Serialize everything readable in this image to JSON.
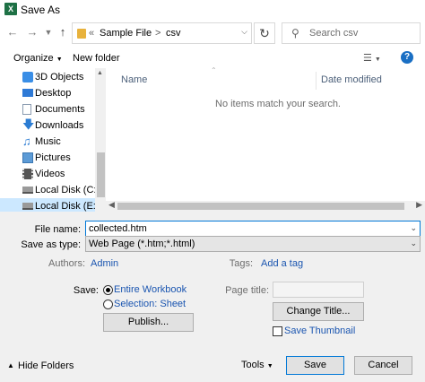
{
  "window": {
    "title": "Save As",
    "app_icon": "excel-icon"
  },
  "nav": {
    "back_icon": "back-arrow-icon",
    "forward_icon": "forward-arrow-icon",
    "dropdown_icon": "recent-dropdown-icon",
    "up_icon": "up-arrow-icon",
    "address": {
      "overflow": "«",
      "crumbs": [
        "Sample File",
        "csv"
      ],
      "separator": ">"
    },
    "search_placeholder": "Search csv"
  },
  "toolbar": {
    "organize": "Organize",
    "new_folder": "New folder"
  },
  "sidebar": {
    "items": [
      {
        "label": "3D Objects",
        "icon": "3d-objects-icon",
        "color": "#3a8ee6"
      },
      {
        "label": "Desktop",
        "icon": "desktop-icon",
        "color": "#2f7ad6"
      },
      {
        "label": "Documents",
        "icon": "documents-icon",
        "color": "#8a9bb0"
      },
      {
        "label": "Downloads",
        "icon": "downloads-icon",
        "color": "#2b7cd3"
      },
      {
        "label": "Music",
        "icon": "music-icon",
        "color": "#2b7cd3"
      },
      {
        "label": "Pictures",
        "icon": "pictures-icon",
        "color": "#5c9bd6"
      },
      {
        "label": "Videos",
        "icon": "videos-icon",
        "color": "#555555"
      },
      {
        "label": "Local Disk (C:)",
        "icon": "drive-icon",
        "color": "#7d7d7d"
      },
      {
        "label": "Local Disk (E:)",
        "icon": "drive-icon",
        "color": "#7d7d7d",
        "selected": true
      }
    ]
  },
  "files": {
    "columns": [
      "Name",
      "Date modified"
    ],
    "empty_message": "No items match your search."
  },
  "form": {
    "file_name_label": "File name:",
    "file_name_value": "collected.htm",
    "save_as_type_label": "Save as type:",
    "save_as_type_value": "Web Page (*.htm;*.html)",
    "authors_label": "Authors:",
    "authors_value": "Admin",
    "tags_label": "Tags:",
    "tags_value": "Add a tag",
    "save_label": "Save:",
    "entire_workbook": "Entire Workbook",
    "selection_sheet": "Selection: Sheet",
    "publish": "Publish...",
    "page_title_label": "Page title:",
    "page_title_value": "",
    "change_title": "Change Title...",
    "save_thumbnail": "Save Thumbnail"
  },
  "footer": {
    "hide_folders": "Hide Folders",
    "tools": "Tools",
    "save": "Save",
    "cancel": "Cancel"
  },
  "colors": {
    "accent": "#0078d7",
    "link": "#1a55b0",
    "selected_bg": "#cce8ff",
    "panel_bg": "#f0f0f0"
  }
}
